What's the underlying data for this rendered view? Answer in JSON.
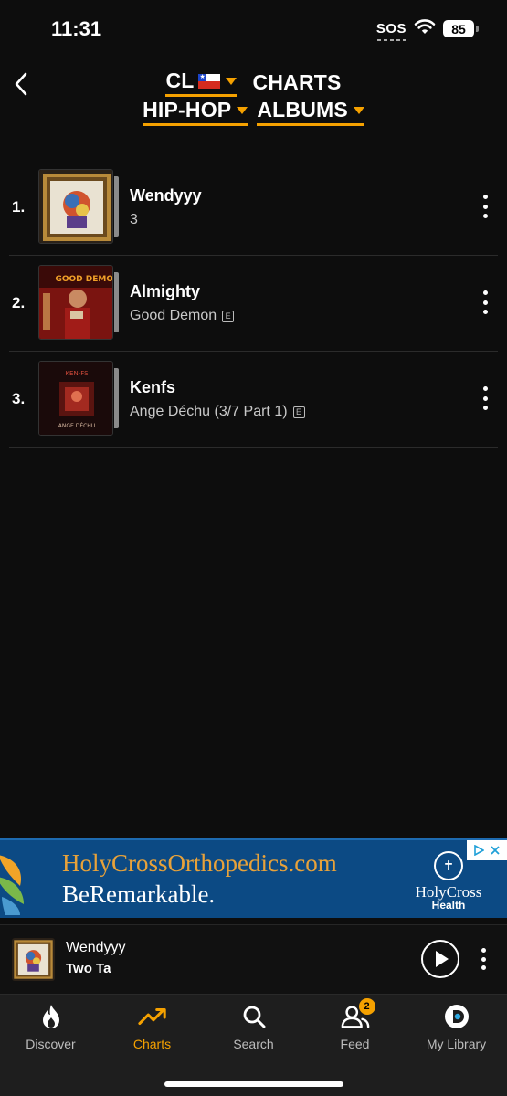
{
  "status_bar": {
    "time": "11:31",
    "sos": "SOS",
    "battery": "85"
  },
  "header": {
    "country": "CL",
    "charts_label": "CHARTS",
    "genre": "HIP-HOP",
    "type": "ALBUMS",
    "accent_color": "#f5a100"
  },
  "chart_rows": [
    {
      "rank": "1.",
      "title": "Wendyyy",
      "subtitle": "3",
      "explicit": false,
      "explicit_mark": ""
    },
    {
      "rank": "2.",
      "title": "Almighty",
      "subtitle": "Good Demon",
      "explicit": true,
      "explicit_mark": "E"
    },
    {
      "rank": "3.",
      "title": "Kenfs",
      "subtitle": "Ange Déchu (3/7 Part 1)",
      "explicit": true,
      "explicit_mark": "E"
    }
  ],
  "cover_text": {
    "album2_top": "GOOD DEMON",
    "album3_top": "KEN-FS",
    "album3_bottom": "ANGE DÉCHU"
  },
  "ad": {
    "url": "HolyCrossOrthopedics.com",
    "tagline": "BeRemarkable.",
    "brand": "HolyCross",
    "brand_sub": "Health"
  },
  "player": {
    "title": "Wendyyy",
    "artist": "Two Ta"
  },
  "tabs": [
    {
      "label": "Discover",
      "icon": "flame-icon"
    },
    {
      "label": "Charts",
      "icon": "trending-up-icon"
    },
    {
      "label": "Search",
      "icon": "search-icon"
    },
    {
      "label": "Feed",
      "icon": "people-icon",
      "badge": "2"
    },
    {
      "label": "My Library",
      "icon": "library-icon"
    }
  ]
}
